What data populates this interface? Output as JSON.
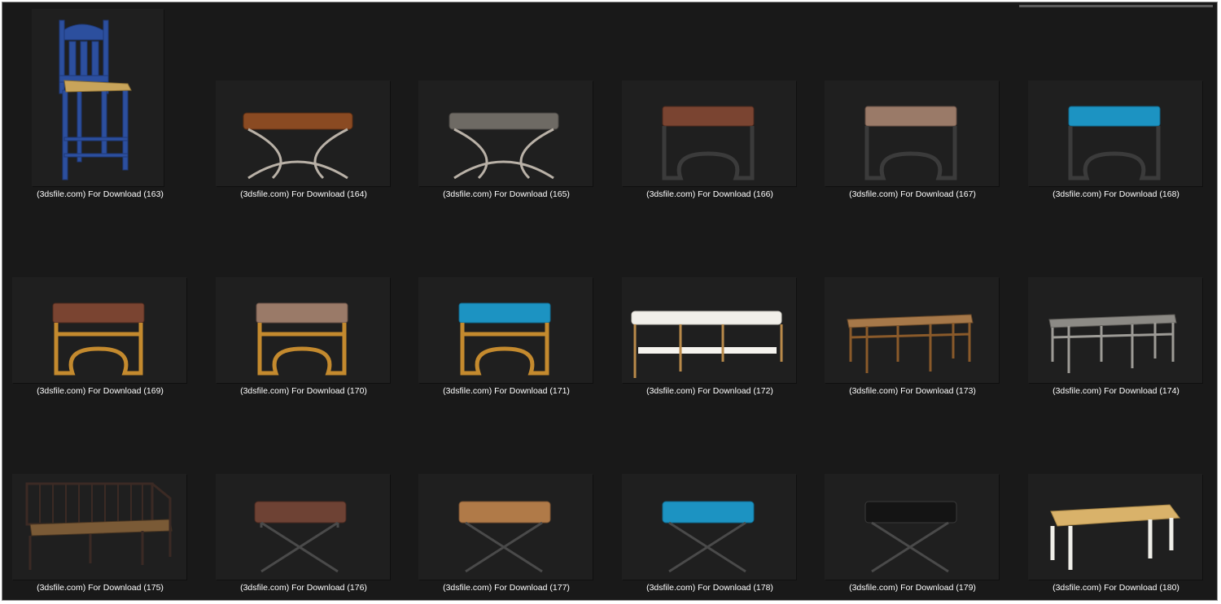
{
  "colors": {
    "background": "#191919",
    "thumb_bg": "#1f1f1f",
    "label": "#ffffff"
  },
  "files": [
    {
      "name": "(3dsfile.com) For Download (163)",
      "icon": "blue-bar-chair-icon"
    },
    {
      "name": "(3dsfile.com) For Download (164)",
      "icon": "brown-x-bench-icon"
    },
    {
      "name": "(3dsfile.com) For Download (165)",
      "icon": "grey-x-bench-icon"
    },
    {
      "name": "(3dsfile.com) For Download (166)",
      "icon": "brown-curved-stool-icon"
    },
    {
      "name": "(3dsfile.com) For Download (167)",
      "icon": "taupe-curved-stool-icon"
    },
    {
      "name": "(3dsfile.com) For Download (168)",
      "icon": "teal-curved-stool-icon"
    },
    {
      "name": "(3dsfile.com) For Download (169)",
      "icon": "brown-gold-stool-icon"
    },
    {
      "name": "(3dsfile.com) For Download (170)",
      "icon": "taupe-gold-stool-icon"
    },
    {
      "name": "(3dsfile.com) For Download (171)",
      "icon": "teal-gold-stool-icon"
    },
    {
      "name": "(3dsfile.com) For Download (172)",
      "icon": "white-shelf-bench-icon"
    },
    {
      "name": "(3dsfile.com) For Download (173)",
      "icon": "bamboo-bench-icon"
    },
    {
      "name": "(3dsfile.com) For Download (174)",
      "icon": "grey-bamboo-bench-icon"
    },
    {
      "name": "(3dsfile.com) For Download (175)",
      "icon": "spindle-settee-icon"
    },
    {
      "name": "(3dsfile.com) For Download (176)",
      "icon": "brown-x-stool-icon"
    },
    {
      "name": "(3dsfile.com) For Download (177)",
      "icon": "tan-x-stool-icon"
    },
    {
      "name": "(3dsfile.com) For Download (178)",
      "icon": "teal-x-stool-icon"
    },
    {
      "name": "(3dsfile.com) For Download (179)",
      "icon": "black-x-stool-icon"
    },
    {
      "name": "(3dsfile.com) For Download (180)",
      "icon": "cream-bench-icon"
    }
  ]
}
